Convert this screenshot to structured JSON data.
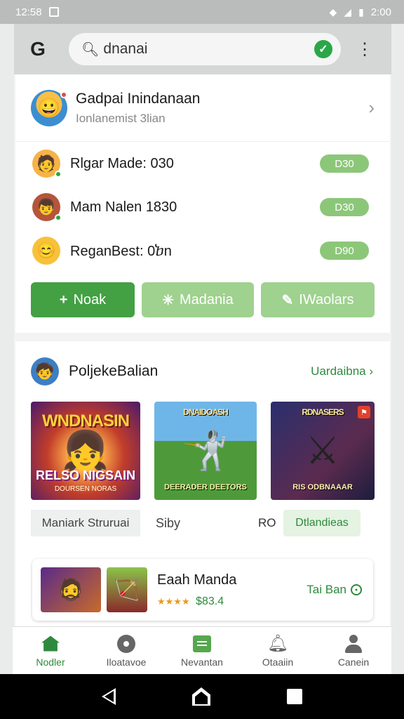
{
  "status": {
    "time": "12:58",
    "right_time": "2:00"
  },
  "search": {
    "query": "dnanai"
  },
  "profile": {
    "name": "Gadpai Inindanaan",
    "subtitle": "Ionlanemist 3lian"
  },
  "friends": [
    {
      "name": "Rlgar Made: 030",
      "badge": "D30"
    },
    {
      "name": "Mam Nalen 1830",
      "badge": "D30"
    },
    {
      "name": "ReganBest: 0ⴆn",
      "badge": "D90"
    }
  ],
  "actions": [
    {
      "icon": "+",
      "label": "Noak"
    },
    {
      "icon": "✳",
      "label": "Madania"
    },
    {
      "icon": "✎",
      "label": "IWaolars"
    }
  ],
  "section": {
    "title": "PoljekeBalian",
    "more": "Uardaibna ›"
  },
  "games": [
    {
      "title": "WNDNASIN",
      "subtitle": "RELSO NIGSAIN",
      "subtitle2": "DOURSEN NORAS"
    },
    {
      "title": "DNAIDOASH",
      "subtitle": "DEERADER DEETORS"
    },
    {
      "title": "RDNASERS",
      "subtitle": "RIS ODBNAAAR"
    }
  ],
  "captions": {
    "c1": "Maniark Struruai",
    "c2": "Siby",
    "c3": "RO",
    "c4": "Dtlandieas"
  },
  "featured": {
    "title": "Eaah Manda",
    "stars": "★★★★",
    "price": "$83.4",
    "cta": "Tai Ban"
  },
  "bottom_nav": [
    {
      "label": "Nodler",
      "icon": "home-icon",
      "active": true
    },
    {
      "label": "Iloatavoe",
      "icon": "location-pin-icon",
      "active": false
    },
    {
      "label": "Nevantan",
      "icon": "list-card-icon",
      "active": false
    },
    {
      "label": "Otaaiin",
      "icon": "bell-icon",
      "active": false
    },
    {
      "label": "Canein",
      "icon": "user-icon",
      "active": false
    }
  ],
  "colors": {
    "accent": "#2d8a3d",
    "primary_button": "#43a043",
    "light_button": "#9fd18f",
    "pill": "#8cc779"
  }
}
